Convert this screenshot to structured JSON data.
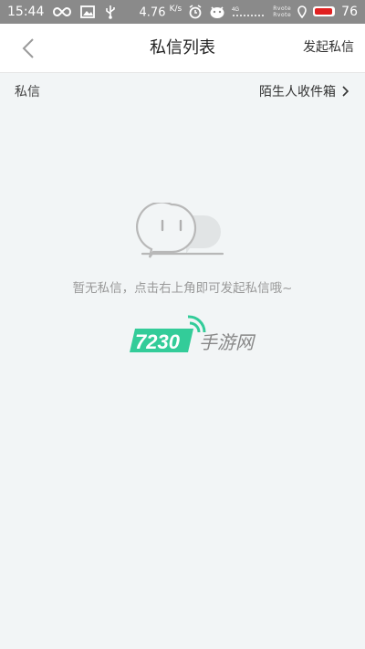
{
  "status_bar": {
    "time": "15:44",
    "speed_value": "4.76",
    "speed_unit": "K/s",
    "battery": "76",
    "tiny_labels": [
      "Rvote",
      "Rvote"
    ],
    "colors": {
      "bar_bg": "#8a8a8a",
      "battery_fill": "#e02020"
    }
  },
  "nav": {
    "back_icon": "chevron-left-icon",
    "title": "私信列表",
    "action": "发起私信"
  },
  "section": {
    "label": "私信",
    "stranger_inbox": "陌生人收件箱",
    "chevron_icon": "chevron-right-icon"
  },
  "empty_state": {
    "icon": "chat-bubbles-icon",
    "message": "暂无私信，点击右上角即可发起私信哦~"
  },
  "watermark": {
    "number": "7230",
    "text": "手游网",
    "colors": {
      "badge": "#33cc99",
      "text": "#888888"
    }
  }
}
